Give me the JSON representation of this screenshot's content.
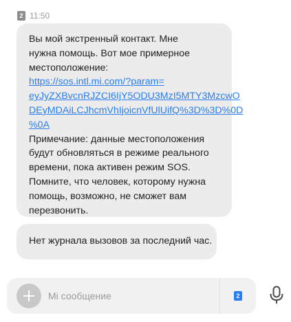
{
  "header": {
    "sim_slot": "2",
    "time": "11:50"
  },
  "messages": [
    {
      "lines": [
        "Вы мой экстренный контакт. Мне",
        "нужна помощь. Вот мое примерное",
        "местоположение:"
      ],
      "link_lines": [
        "https://sos.intl.mi.com/?param=",
        "eyJyZXBvcnRJZCI6IjY5ODU3MzI5MTY3MzcwO",
        "DEyMDAiLCJhcmVhIjoicnVfUlUifQ%3D%3D%0D",
        "%0A"
      ],
      "note_lines": [
        "Примечание: данные местоположения",
        "будут обновляться в режиме реального",
        "времени, пока активен режим SOS.",
        "Помните, что человек, которому нужна",
        "помощь, возможно, не сможет вам",
        "перезвонить."
      ]
    },
    {
      "text": "Нет журнала вызовов за последний час."
    }
  ],
  "composer": {
    "placeholder": "Mi сообщение",
    "value": "",
    "send_sim_slot": "2",
    "icons": {
      "add": "plus-icon",
      "mic": "microphone-icon"
    }
  },
  "colors": {
    "bubble": "#ececec",
    "link": "#2a7df0",
    "sim_badge": "#8e8e8e",
    "send_sim_badge": "#2a7df0"
  }
}
